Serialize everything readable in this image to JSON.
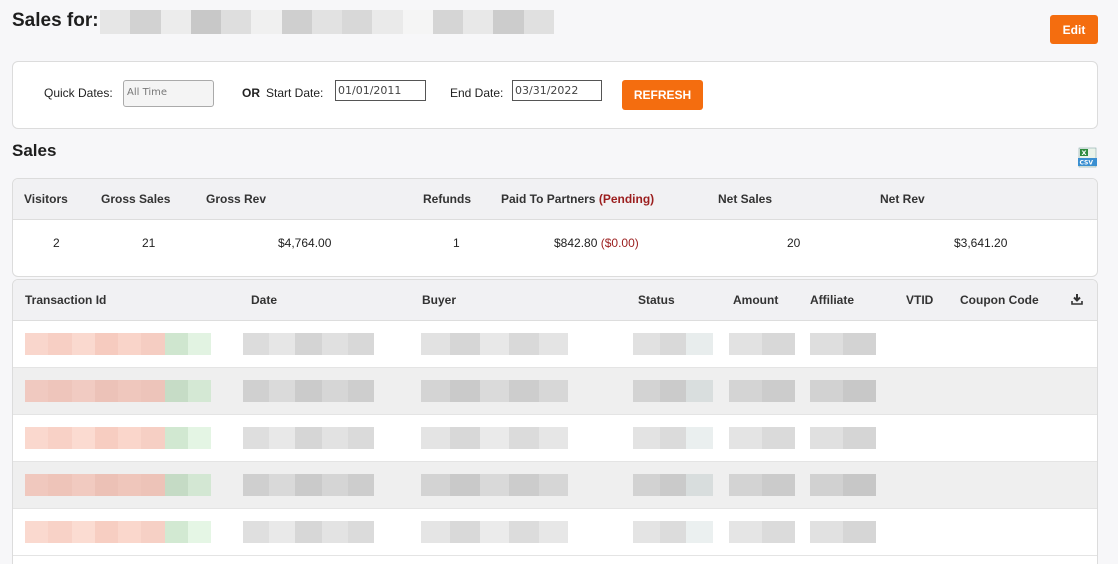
{
  "header": {
    "title": "Sales for:",
    "edit_label": "Edit"
  },
  "filters": {
    "quick_dates_label": "Quick Dates:",
    "quick_dates_value": "All Time",
    "or_label": "OR",
    "start_label": "Start Date:",
    "start_value": "01/01/2011",
    "end_label": "End Date:",
    "end_value": "03/31/2022",
    "refresh_label": "REFRESH"
  },
  "sales": {
    "title": "Sales",
    "export_icon": "excel-csv-icon",
    "columns": {
      "visitors": "Visitors",
      "gross_sales": "Gross Sales",
      "gross_rev": "Gross Rev",
      "refunds": "Refunds",
      "paid_to_partners": "Paid To Partners",
      "pending": "(Pending)",
      "net_sales": "Net Sales",
      "net_rev": "Net Rev"
    },
    "values": {
      "visitors": "2",
      "gross_sales": "21",
      "gross_rev": "$4,764.00",
      "refunds": "1",
      "paid_to_partners": "$842.80",
      "pending": "($0.00)",
      "net_sales": "20",
      "net_rev": "$3,641.20"
    }
  },
  "transactions": {
    "columns": {
      "id": "Transaction Id",
      "date": "Date",
      "buyer": "Buyer",
      "status": "Status",
      "amount": "Amount",
      "affiliate": "Affiliate",
      "vtid": "VTID",
      "coupon": "Coupon Code"
    },
    "download_icon": "download-icon"
  },
  "colors": {
    "accent": "#f46d0f",
    "pending": "#9b1e1e"
  }
}
